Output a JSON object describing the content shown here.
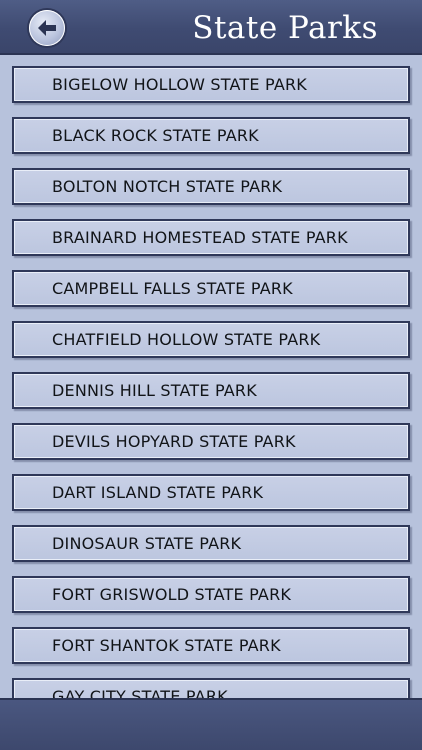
{
  "header": {
    "title": "State Parks",
    "back_icon": "back-arrow-icon"
  },
  "parks": [
    "BIGELOW HOLLOW STATE PARK",
    "BLACK ROCK STATE PARK",
    "BOLTON NOTCH STATE PARK",
    "BRAINARD HOMESTEAD STATE PARK",
    "CAMPBELL FALLS STATE PARK",
    "CHATFIELD HOLLOW STATE PARK",
    "DENNIS HILL STATE PARK",
    "DEVILS HOPYARD STATE PARK",
    "DART ISLAND STATE PARK",
    "DINOSAUR STATE PARK",
    "FORT GRISWOLD STATE PARK",
    "FORT SHANTOK STATE PARK",
    "GAY CITY STATE PARK"
  ],
  "colors": {
    "header_bg": "#3f4b72",
    "list_bg": "#b7c2dc",
    "row_bg": "#c4cce3",
    "row_border": "#2f3859"
  }
}
